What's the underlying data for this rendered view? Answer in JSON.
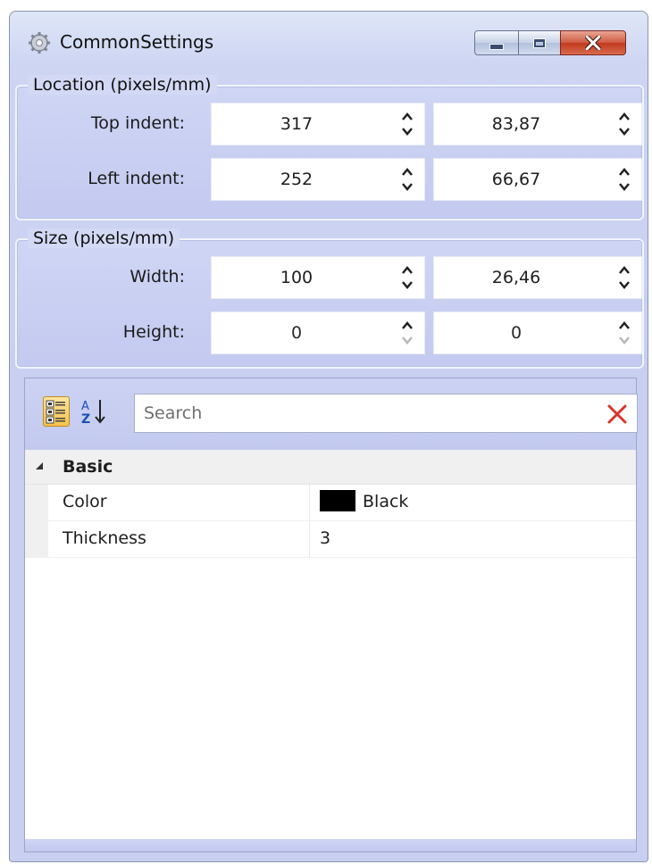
{
  "window": {
    "title": "CommonSettings"
  },
  "location_group": {
    "title": "Location (pixels/mm)",
    "rows": [
      {
        "label": "Top indent:",
        "pixels": "317",
        "mm": "83,87"
      },
      {
        "label": "Left indent:",
        "pixels": "252",
        "mm": "66,67"
      }
    ]
  },
  "size_group": {
    "title": "Size (pixels/mm)",
    "rows": [
      {
        "label": "Width:",
        "pixels": "100",
        "mm": "26,46"
      },
      {
        "label": "Height:",
        "pixels": "0",
        "mm": "0"
      }
    ]
  },
  "properties": {
    "search_placeholder": "Search",
    "category": "Basic",
    "items": [
      {
        "name": "Color",
        "value": "Black",
        "swatch": "#000000"
      },
      {
        "name": "Thickness",
        "value": "3"
      }
    ]
  },
  "colors": {
    "accent": "#c9cff1",
    "close_button": "#c2391f",
    "clear_icon": "#d9342b"
  }
}
